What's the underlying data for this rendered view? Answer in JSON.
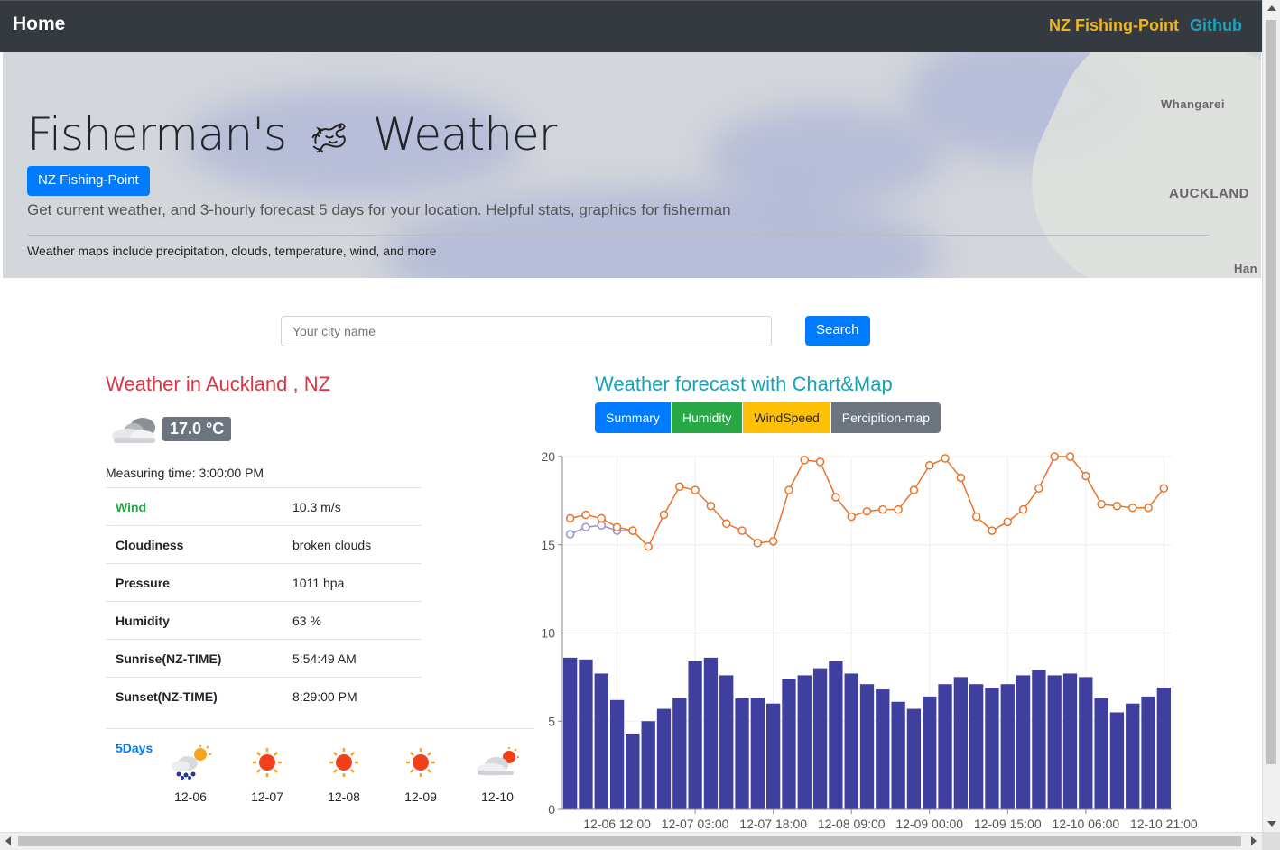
{
  "nav": {
    "brand": "Home",
    "link1": "NZ Fishing-Point",
    "link2": "Github"
  },
  "hero": {
    "title_left": "Fisherman's",
    "title_right": "Weather",
    "button": "NZ Fishing-Point",
    "lead": "Get current weather, and 3-hourly forecast 5 days for your location. Helpful stats, graphics for fisherman",
    "sub": "Weather maps include precipitation, clouds, temperature, wind, and more",
    "map_labels": [
      "Whangarei",
      "AUCKLAND",
      "Han"
    ]
  },
  "search": {
    "placeholder": "Your city name",
    "button": "Search"
  },
  "current": {
    "title": "Weather in Auckland , NZ",
    "temp": "17.0 °C",
    "measuring": "Measuring time: 3:00:00 PM",
    "rows": [
      {
        "key": "Wind",
        "value": "10.3 m/s"
      },
      {
        "key": "Cloudiness",
        "value": "broken clouds"
      },
      {
        "key": "Pressure",
        "value": "1011 hpa"
      },
      {
        "key": "Humidity",
        "value": "63 %"
      },
      {
        "key": "Sunrise(NZ-TIME)",
        "value": "5:54:49 AM"
      },
      {
        "key": "Sunset(NZ-TIME)",
        "value": "8:29:00 PM"
      }
    ],
    "five_label": "5Days",
    "days": [
      {
        "date": "12-06",
        "icon": "rain-sun-icon"
      },
      {
        "date": "12-07",
        "icon": "sun-icon"
      },
      {
        "date": "12-08",
        "icon": "sun-icon"
      },
      {
        "date": "12-09",
        "icon": "sun-icon"
      },
      {
        "date": "12-10",
        "icon": "cloud-sun-icon"
      }
    ]
  },
  "forecast": {
    "title": "Weather forecast with Chart&Map",
    "tabs": [
      {
        "label": "Summary",
        "color": "#007bff"
      },
      {
        "label": "Humidity",
        "color": "#28a745"
      },
      {
        "label": "WindSpeed",
        "color": "#ffc107"
      },
      {
        "label": "Percipition-map",
        "color": "#6c757d"
      }
    ]
  },
  "chart_data": {
    "type": "bar",
    "ylim": [
      0,
      20
    ],
    "yticks": [
      0,
      5,
      10,
      15,
      20
    ],
    "xtick_labels": [
      "12-06 12:00",
      "12-07 03:00",
      "12-07 18:00",
      "12-08 09:00",
      "12-09 00:00",
      "12-09 15:00",
      "12-10 06:00",
      "12-10 21:00"
    ],
    "grid": true,
    "bar_color": "#3f3f9f",
    "bars": [
      8.6,
      8.5,
      7.7,
      6.2,
      4.3,
      5.0,
      5.7,
      6.3,
      8.4,
      8.6,
      7.6,
      6.3,
      6.3,
      6.0,
      7.4,
      7.6,
      8.0,
      8.4,
      7.7,
      7.1,
      6.8,
      6.1,
      5.7,
      6.4,
      7.1,
      7.5,
      7.1,
      6.9,
      7.1,
      7.6,
      7.9,
      7.6,
      7.7,
      7.5,
      6.3,
      5.5,
      6.0,
      6.4,
      6.9
    ],
    "line_color": "#e8742a",
    "line": [
      16.5,
      16.7,
      16.5,
      16.0,
      15.8,
      14.9,
      16.7,
      18.3,
      18.1,
      17.2,
      16.2,
      15.8,
      15.1,
      15.2,
      18.1,
      19.8,
      19.7,
      17.7,
      16.6,
      16.9,
      17.0,
      17.0,
      18.1,
      19.5,
      19.9,
      18.8,
      16.6,
      15.8,
      16.3,
      17.0,
      18.2,
      20.0,
      20.0,
      18.9,
      17.3,
      17.2,
      17.1,
      17.1,
      18.2
    ],
    "line2_color": "#9b8fcf",
    "line2": [
      15.6,
      16.0,
      16.1,
      15.8,
      15.8
    ]
  }
}
